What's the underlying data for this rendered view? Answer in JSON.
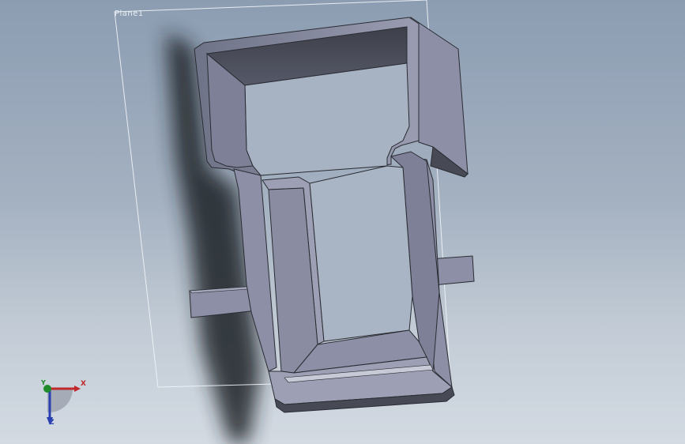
{
  "viewport": {
    "background_top": "#8c9db2",
    "background_bottom": "#d3dae2"
  },
  "plane": {
    "label": "Plane1",
    "border_color": "#f2f5f8"
  },
  "model": {
    "face_color": "#8c8fa6",
    "dark_face_color": "#474a55",
    "edge_color": "#2a2c33",
    "shadow_color": "#1f2226"
  },
  "triad": {
    "x_label": "X",
    "y_label": "Y",
    "z_label": "Z",
    "x_color": "#c0282c",
    "y_color": "#1f8a2a",
    "z_color": "#2a3fb0"
  }
}
